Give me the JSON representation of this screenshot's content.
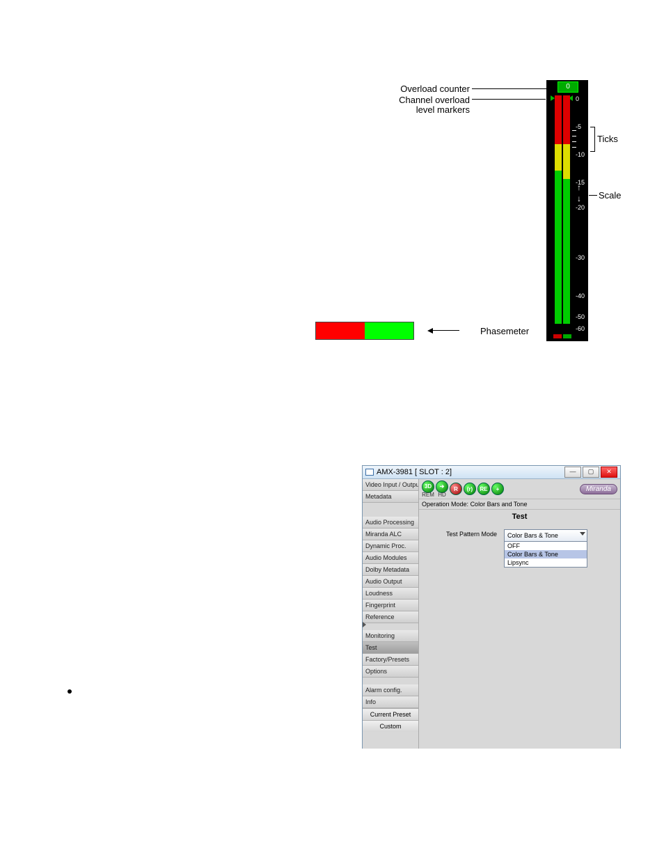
{
  "vu": {
    "label_overload_counter": "Overload counter",
    "label_channel_overload": "Channel overload",
    "label_level_markers": "level markers",
    "label_ticks": "Ticks",
    "label_scale": "Scale",
    "label_phasemeter": "Phasemeter",
    "overload_value": "0",
    "ticks": [
      "0",
      "-5",
      "-10",
      "-15",
      "-20",
      "-30",
      "-40",
      "-50",
      "-60"
    ]
  },
  "window": {
    "title": "AMX-3981 [ SLOT : 2]",
    "min": "—",
    "max": "▢",
    "close": "✕",
    "sidebar": {
      "items_top": [
        "Video Input / Output",
        "Metadata"
      ],
      "items_mid": [
        "Audio Processing",
        "Miranda ALC",
        "Dynamic Proc.",
        "Audio Modules",
        "Dolby Metadata",
        "Audio Output",
        "Loudness",
        "Fingerprint",
        "Reference"
      ],
      "items_low": [
        "Monitoring",
        "Test",
        "Factory/Presets",
        "Options"
      ],
      "items_bot": [
        "Alarm config.",
        "Info"
      ],
      "current_preset_label": "Current Preset",
      "current_preset_value": "Custom",
      "selected": "Test",
      "arrow_on": "Fingerprint"
    },
    "icons": {
      "sub_left": "REM",
      "sub_right": "HD",
      "brand": "Miranda",
      "i1": "3D",
      "i2": "➔",
      "i3": "R",
      "i4": "(r)",
      "i5": "RE",
      "i6": "+"
    },
    "opmode_label": "Operation Mode:",
    "opmode_value": "Color Bars and Tone",
    "panel_title": "Test",
    "form_label": "Test Pattern Mode",
    "combo_value": "Color Bars & Tone",
    "dropdown": [
      "OFF",
      "Color Bars & Tone",
      "Lipsync"
    ],
    "dropdown_selected": "Color Bars & Tone"
  }
}
